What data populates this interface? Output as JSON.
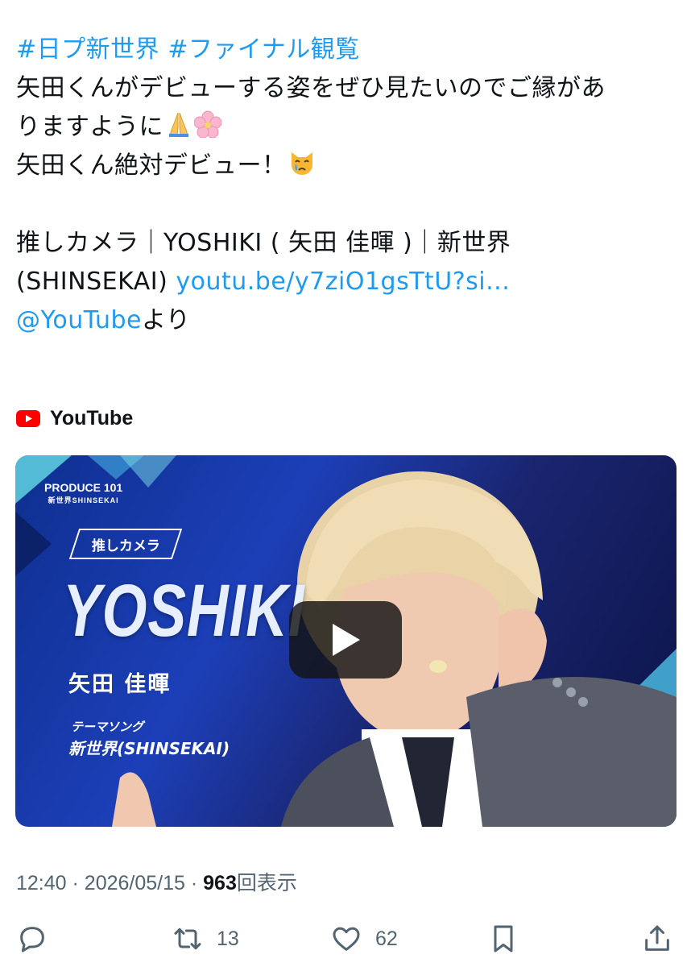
{
  "tweet": {
    "hashtag1": "#日プ新世界",
    "hashtag2": "#ファイナル観覧",
    "line1": "矢田くんがデビューする姿をぜひ見たいのでご縁があ",
    "line2": "りますように",
    "line3": "矢田くん絶対デビュー！",
    "line4": "推しカメラ｜YOSHIKI ( 矢田 佳暉 )｜新世界",
    "line5_text": "(SHINSEKAI) ",
    "link_url": "youtu.be/y7ziO1gsTtU?si...",
    "mention": "@YouTube",
    "mention_suffix": "より"
  },
  "card": {
    "source_label": "YouTube",
    "brand_color": "#ff0000",
    "thumbnail": {
      "show_logo_line1": "PRODUCE 101",
      "show_logo_line2": "新世界SHINSEKAI",
      "badge": "推しカメラ",
      "name_en": "YOSHIKI",
      "name_jp": "矢田 佳暉",
      "song_label": "テーマソング",
      "song_title": "新世界(SHINSEKAI)"
    }
  },
  "meta": {
    "time": "12:40",
    "date": "2026/05/15",
    "separator": "·",
    "views": "963",
    "views_label": "回表示"
  },
  "actions": {
    "retweet_count": "13",
    "like_count": "62"
  },
  "colors": {
    "link": "#1d9bf0",
    "text": "#0f1419",
    "muted": "#536471"
  },
  "icons": [
    "reply-icon",
    "retweet-icon",
    "like-icon",
    "bookmark-icon",
    "share-icon",
    "play-icon",
    "folded-hands-emoji",
    "cherry-blossom-emoji",
    "crying-cat-emoji"
  ]
}
